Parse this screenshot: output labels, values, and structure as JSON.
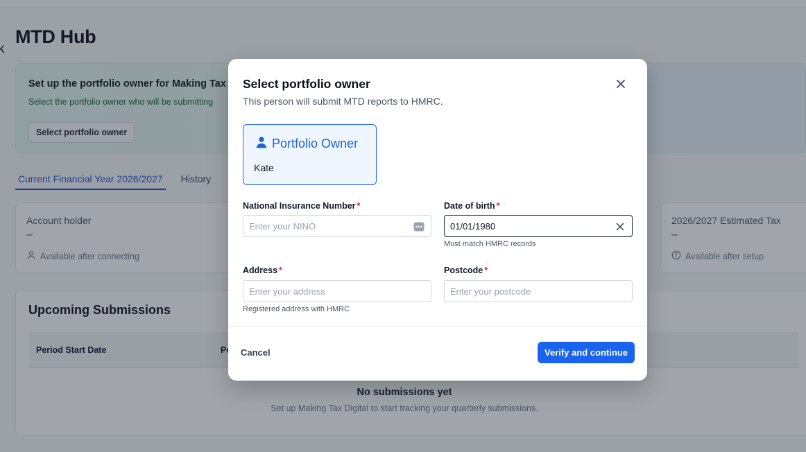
{
  "page": {
    "back_glyph": "k",
    "title": "MTD Hub"
  },
  "banner": {
    "title": "Set up the portfolio owner for Making Tax",
    "subtitle": "Select the portfolio owner who will be submitting",
    "button_label": "Select portfolio owner"
  },
  "tabs": [
    {
      "label": "Current Financial Year 2026/2027",
      "active": true
    },
    {
      "label": "History",
      "active": false
    }
  ],
  "cards": {
    "account_holder": {
      "label": "Account holder",
      "value": "–",
      "footer": "Available after connecting"
    },
    "estimated_tax": {
      "label": "2026/2027 Estimated Tax",
      "value": "–",
      "footer": "Available after setup"
    }
  },
  "submissions": {
    "title": "Upcoming Submissions",
    "columns": [
      "Period Start Date",
      "Pe"
    ],
    "empty_title": "No submissions yet",
    "empty_subtitle": "Set up Making Tax Digital to start tracking your quarterly submissions."
  },
  "modal": {
    "title": "Select portfolio owner",
    "subtitle": "This person will submit MTD reports to HMRC.",
    "owner": {
      "role": "Portfolio Owner",
      "name": "Kate"
    },
    "fields": {
      "nino": {
        "label": "National Insurance Number",
        "required": "*",
        "placeholder": "Enter your NINO",
        "value": ""
      },
      "dob": {
        "label": "Date of birth",
        "required": "*",
        "value": "01/01/1980",
        "hint": "Must match HMRC records"
      },
      "address": {
        "label": "Address",
        "required": "*",
        "placeholder": "Enter your address",
        "hint": "Registered address with HMRC"
      },
      "postcode": {
        "label": "Postcode",
        "required": "*",
        "placeholder": "Enter your postcode"
      }
    },
    "cancel_label": "Cancel",
    "primary_label": "Verify and continue"
  },
  "colors": {
    "accent": "#1a62f0",
    "required": "#dc2626",
    "owner_text": "#1d63d8"
  },
  "icons": {
    "close": "close-icon",
    "user": "user-icon",
    "info": "info-icon",
    "password_manager": "password-manager-icon",
    "clear": "clear-icon"
  }
}
